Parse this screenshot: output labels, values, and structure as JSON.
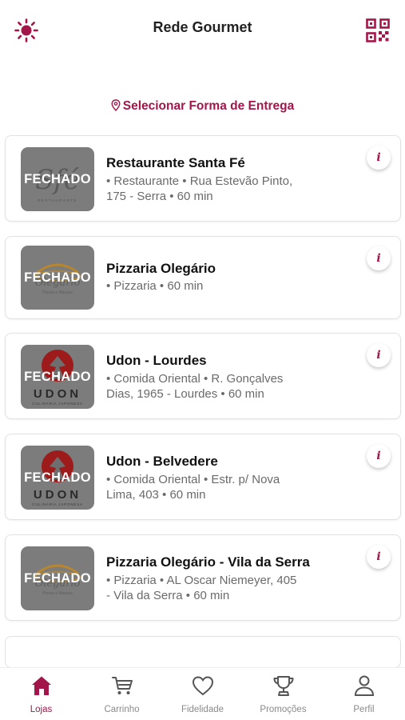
{
  "header": {
    "title": "Rede Gourmet",
    "left_icon": "sun-icon",
    "right_icon": "qr-code-icon"
  },
  "delivery": {
    "icon": "location-pin-icon",
    "label": "Selecionar Forma de Entrega"
  },
  "colors": {
    "accent": "#a3164a",
    "muted_text": "#6a6a6a",
    "card_border": "#e1e1e1",
    "closed_overlay": "#7c7c7c"
  },
  "stores": [
    {
      "name": "Restaurante Santa Fé",
      "status": "FECHADO",
      "logo": "santa-fe-logo",
      "meta_line1": "• Restaurante  • Rua Estevão Pinto,",
      "meta_line2": "175 - Serra • 60 min",
      "info": "i"
    },
    {
      "name": "Pizzaria Olegário",
      "status": "FECHADO",
      "logo": "olegario-logo",
      "meta_line1": "• Pizzaria   • 60 min",
      "meta_line2": "",
      "info": "i"
    },
    {
      "name": "Udon - Lourdes",
      "status": "FECHADO",
      "logo": "udon-logo",
      "meta_line1": "• Comida Oriental  • R. Gonçalves",
      "meta_line2": "Dias, 1965 - Lourdes • 60 min",
      "info": "i"
    },
    {
      "name": "Udon - Belvedere",
      "status": "FECHADO",
      "logo": "udon-logo",
      "meta_line1": "• Comida Oriental  • Estr. p/ Nova",
      "meta_line2": "Lima, 403 • 60 min",
      "info": "i"
    },
    {
      "name": "Pizzaria Olegário - Vila da Serra",
      "status": "FECHADO",
      "logo": "olegario-logo",
      "meta_line1": "• Pizzaria  • AL Oscar Niemeyer, 405",
      "meta_line2": "- Vila da Serra • 60 min",
      "info": "i"
    }
  ],
  "tabs": [
    {
      "label": "Lojas",
      "icon": "home-icon",
      "active": true
    },
    {
      "label": "Carrinho",
      "icon": "cart-icon",
      "active": false
    },
    {
      "label": "Fidelidade",
      "icon": "heart-icon",
      "active": false
    },
    {
      "label": "Promoções",
      "icon": "trophy-icon",
      "active": false
    },
    {
      "label": "Perfil",
      "icon": "user-icon",
      "active": false
    }
  ]
}
